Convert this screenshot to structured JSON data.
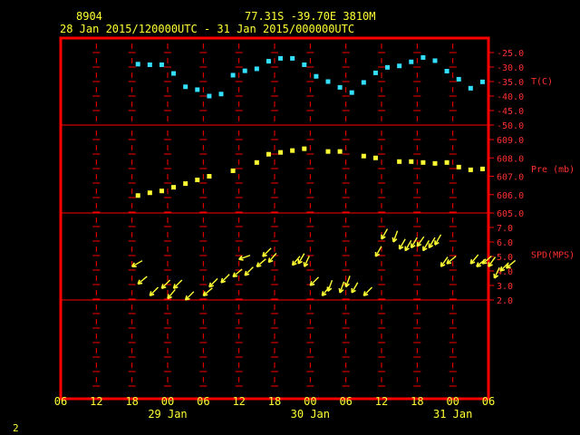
{
  "header": {
    "station_id": "8904",
    "location": "77.31S   -39.70E   3810M",
    "period": "28 Jan 2015/120000UTC - 31 Jan 2015/000000UTC"
  },
  "footer": {
    "page_number": "2"
  },
  "colors": {
    "frame": "#ff0000",
    "text_axis": "#ffff33",
    "panel_labels": "#ff3030",
    "temperature": "#33e0ff",
    "pressure": "#ffff33",
    "wind": "#ffff33"
  },
  "chart_data": [
    {
      "type": "scatter",
      "ylabel": "T(C)",
      "ylim": [
        -50,
        -25
      ],
      "ticks": [
        "-25.0",
        "-30.0",
        "-35.0",
        "-40.0",
        "-45.0",
        "-50.0"
      ],
      "x_hours": [
        13,
        15,
        17,
        19,
        21,
        23,
        25,
        27,
        29,
        31,
        33,
        35,
        37,
        39,
        41,
        43,
        45,
        47,
        49,
        51,
        53,
        55,
        57,
        59,
        61,
        63,
        65,
        67,
        69,
        71
      ],
      "values": [
        -29,
        -29.2,
        -29.2,
        -32.2,
        -36.8,
        -37.8,
        -40,
        -39.3,
        -32.8,
        -31.3,
        -30.6,
        -28,
        -27,
        -27,
        -29.2,
        -33.2,
        -35,
        -37,
        -38.8,
        -35.3,
        -32,
        -30.1,
        -29.6,
        -28.2,
        -26.7,
        -27.8,
        -31.4,
        -34.2,
        -37.3,
        -35.1
      ]
    },
    {
      "type": "scatter",
      "ylabel": "Pre (mb)",
      "ylim": [
        605,
        609
      ],
      "ticks": [
        "609.0",
        "608.0",
        "607.0",
        "606.0",
        "605.0"
      ],
      "x_hours": [
        13,
        15,
        17,
        19,
        21,
        23,
        25,
        29,
        33,
        35,
        37,
        39,
        41,
        45,
        47,
        51,
        53,
        57,
        59,
        61,
        63,
        65,
        67,
        69,
        71
      ],
      "values": [
        605.95,
        606.1,
        606.2,
        606.4,
        606.6,
        606.8,
        607,
        607.3,
        607.75,
        608.2,
        608.3,
        608.4,
        608.5,
        608.35,
        608.35,
        608.1,
        608,
        607.8,
        607.8,
        607.75,
        607.7,
        607.75,
        607.5,
        607.35,
        607.4
      ]
    },
    {
      "type": "scatter",
      "ylabel": "SPD(MPS)",
      "ylim": [
        2,
        7
      ],
      "ticks": [
        "7.0",
        "6.0",
        "5.0",
        "4.0",
        "3.0",
        "2.0"
      ],
      "x_hours": [
        12,
        13,
        15,
        17,
        18,
        19,
        21,
        24,
        25,
        27,
        29,
        30,
        31,
        33,
        34,
        35,
        39,
        40,
        41,
        42,
        44,
        45,
        47,
        48,
        49,
        51,
        53,
        54,
        56,
        57,
        58,
        59,
        60,
        61,
        62,
        63,
        64,
        65,
        69,
        70,
        71,
        72,
        73,
        74,
        75
      ],
      "values": [
        4.3,
        3.1,
        2.3,
        2.8,
        2.1,
        2.8,
        2,
        2.3,
        2.9,
        3.2,
        3.6,
        4.8,
        3.7,
        4.3,
        5,
        4.6,
        4.4,
        4.5,
        4.3,
        3,
        2.3,
        2.6,
        2.5,
        2.9,
        2.5,
        2.3,
        5,
        6.2,
        6,
        5.5,
        5.4,
        5.6,
        5.7,
        5.4,
        5.6,
        5.8,
        4.3,
        4.5,
        4.5,
        4.3,
        4.5,
        4.3,
        3.5,
        4,
        4.2
      ],
      "directions_deg": [
        30,
        40,
        45,
        45,
        50,
        45,
        45,
        40,
        45,
        45,
        40,
        20,
        45,
        40,
        45,
        50,
        50,
        60,
        65,
        45,
        50,
        70,
        70,
        70,
        60,
        45,
        60,
        60,
        70,
        60,
        60,
        60,
        55,
        60,
        60,
        60,
        55,
        40,
        50,
        40,
        40,
        55,
        65,
        45,
        40
      ]
    }
  ],
  "x_axis": {
    "tick_labels": [
      "06",
      "12",
      "18",
      "00",
      "06",
      "12",
      "18",
      "00",
      "06",
      "12",
      "18",
      "00",
      "06"
    ],
    "date_labels": [
      "29 Jan",
      "30 Jan",
      "31 Jan"
    ]
  }
}
